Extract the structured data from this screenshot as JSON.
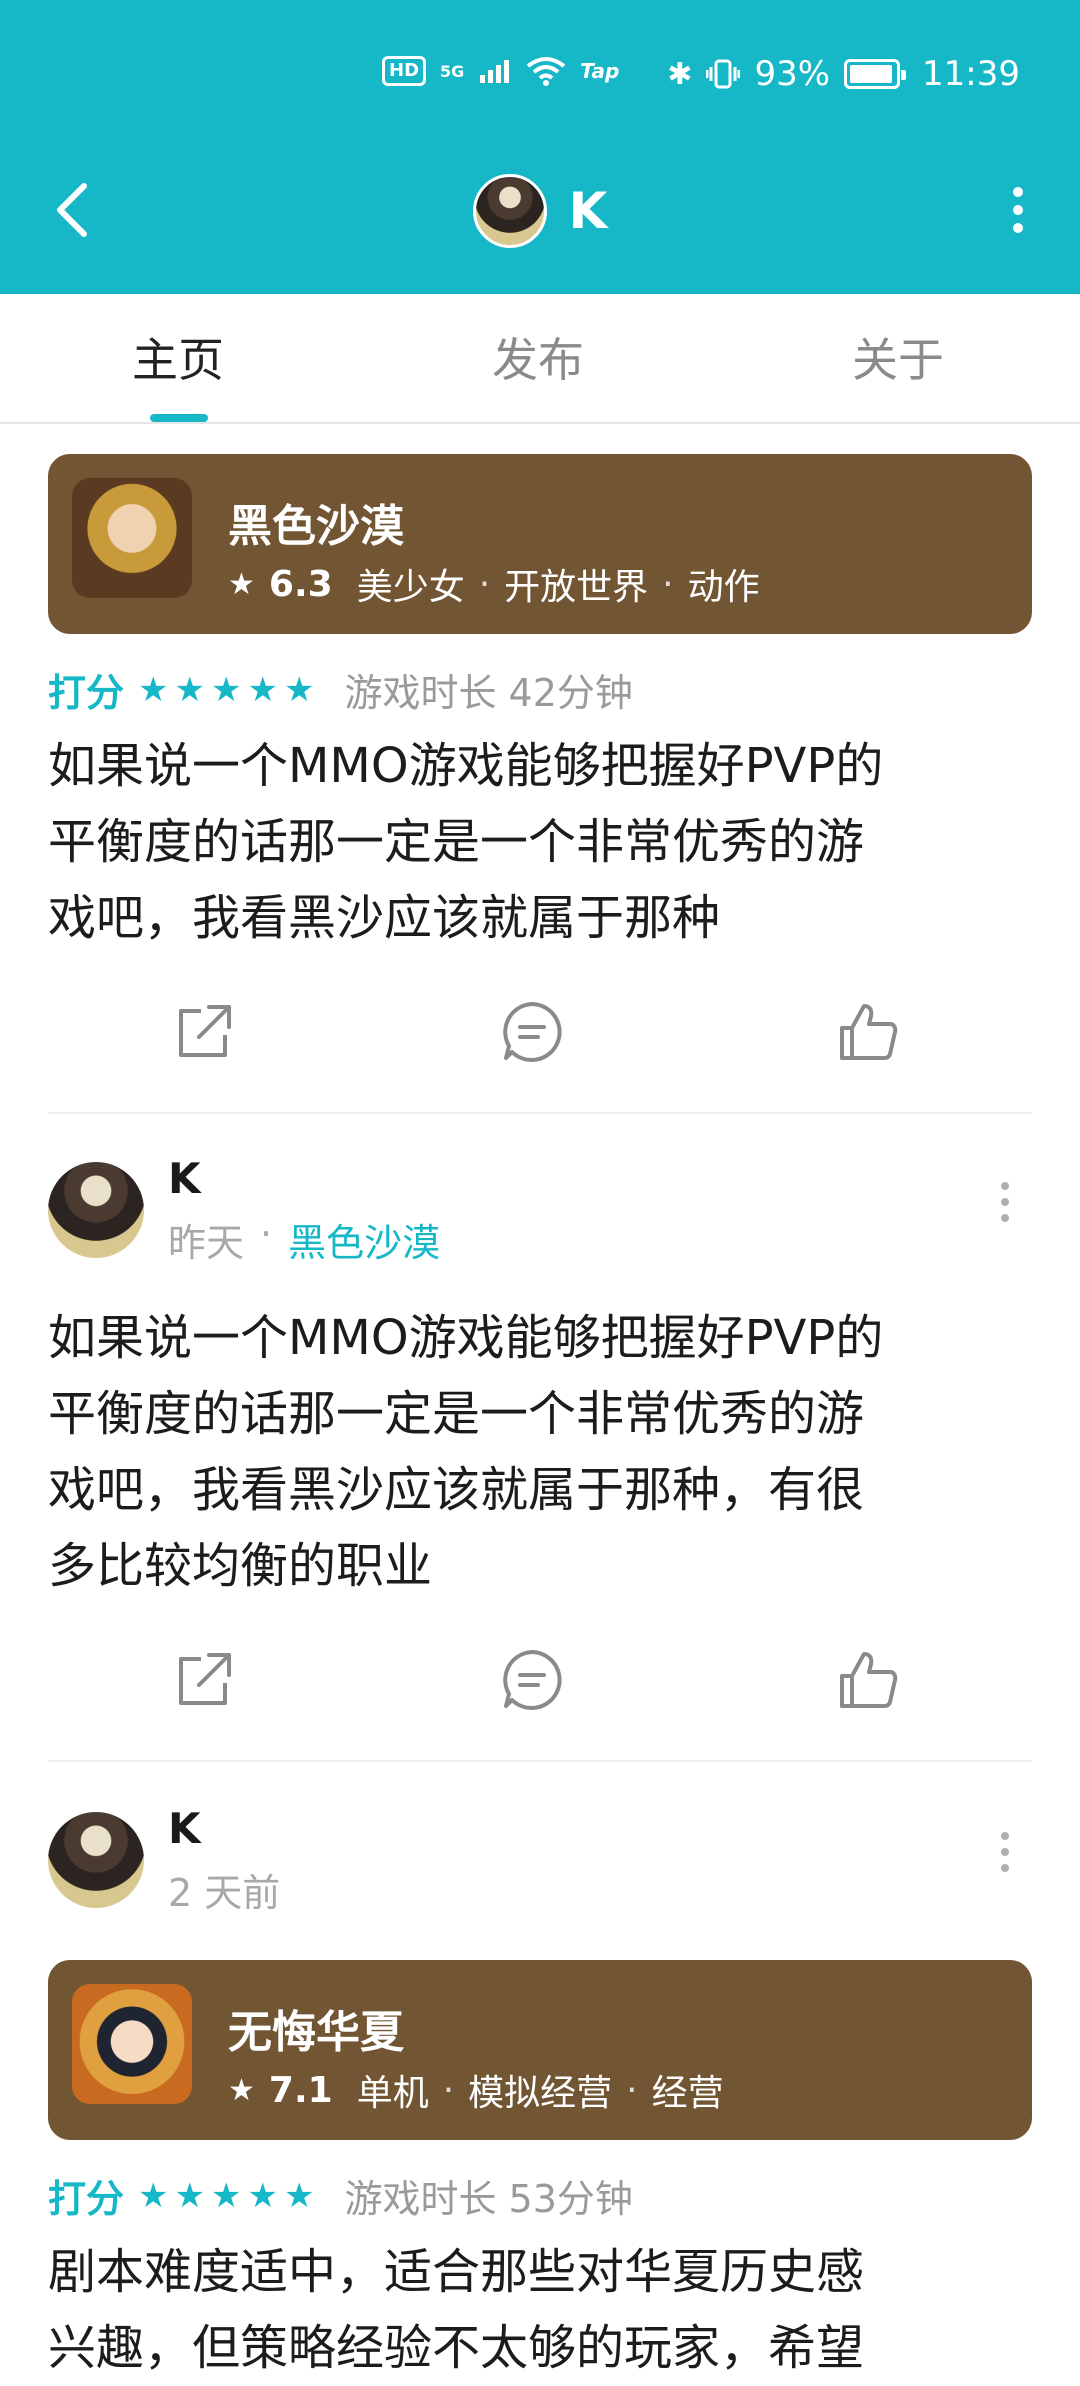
{
  "status_bar": {
    "hd": "HD",
    "network": "5G",
    "tap": "Tap",
    "battery": "93%",
    "time": "11:39"
  },
  "header": {
    "title": "K"
  },
  "tabs": [
    {
      "label": "主页",
      "active": true
    },
    {
      "label": "发布",
      "active": false
    },
    {
      "label": "关于",
      "active": false
    }
  ],
  "colors": {
    "accent": "#16b8c8",
    "card_brown": "#725533"
  },
  "review1": {
    "game": {
      "name": "黑色沙漠",
      "score": "6.3",
      "tags": [
        "美少女",
        "开放世界",
        "动作"
      ]
    },
    "rating_label": "打分",
    "stars": 5,
    "playtime": "游戏时长 42分钟",
    "text_lines": [
      "如果说一个MMO游戏能够把握好PVP的",
      "平衡度的话那一定是一个非常优秀的游",
      "戏吧，我看黑沙应该就属于那种"
    ]
  },
  "post2": {
    "author": "K",
    "time": "昨天",
    "separator": "·",
    "game": "黑色沙漠",
    "text_lines": [
      "如果说一个MMO游戏能够把握好PVP的",
      "平衡度的话那一定是一个非常优秀的游",
      "戏吧，我看黑沙应该就属于那种，有很",
      "多比较均衡的职业"
    ]
  },
  "post3": {
    "author": "K",
    "time": "2 天前",
    "game": {
      "name": "无悔华夏",
      "score": "7.1",
      "tags": [
        "单机",
        "模拟经营",
        "经营"
      ]
    },
    "rating_label": "打分",
    "stars": 5,
    "playtime": "游戏时长 53分钟",
    "text_lines": [
      "剧本难度适中，适合那些对华夏历史感",
      "兴趣，但策略经验不太够的玩家，希望"
    ]
  }
}
